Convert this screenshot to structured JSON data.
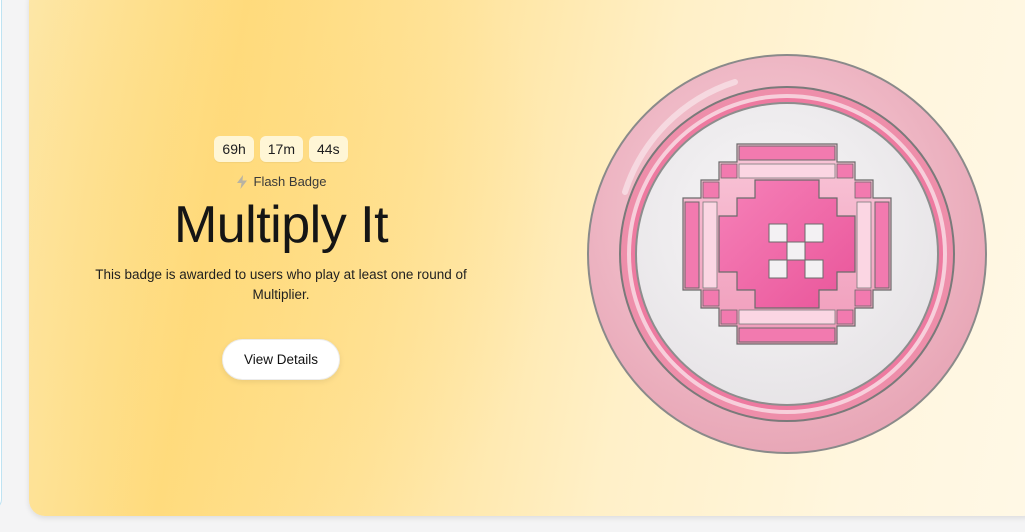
{
  "countdown": {
    "hours": "69h",
    "minutes": "17m",
    "seconds": "44s"
  },
  "badge": {
    "type_label": "Flash Badge",
    "type_icon": "lightning-icon",
    "title": "Multiply It",
    "description": "This badge is awarded to users who play at least one round of Multiplier.",
    "cta_label": "View Details",
    "image_icon": "multiplier-badge-medal"
  },
  "colors": {
    "card_gradient_start": "#ffdb7d",
    "card_gradient_end": "#fff8e6",
    "medal_outer_ring": "#efb9c6",
    "medal_inner_face": "#f1eff1",
    "medal_pixel_pink": "#f06aa8",
    "medal_pixel_light": "#f5a9c6"
  }
}
